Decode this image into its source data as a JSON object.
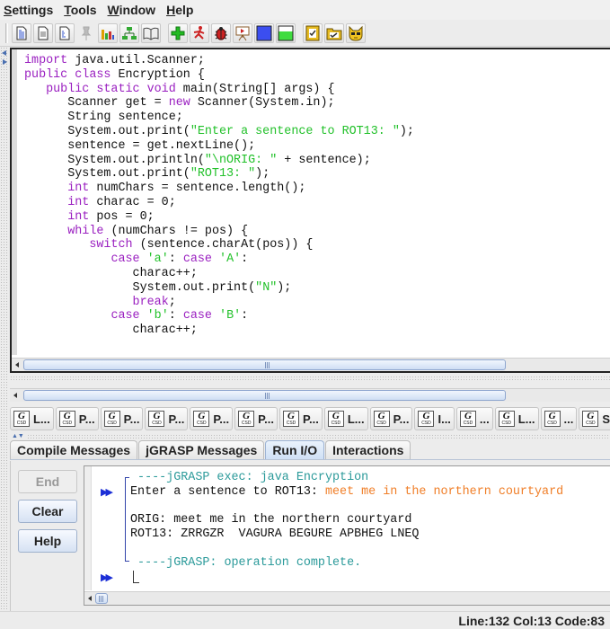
{
  "menubar": {
    "items": [
      {
        "label": "Settings",
        "mnemonic": "S",
        "rest": "ettings"
      },
      {
        "label": "Tools",
        "mnemonic": "T",
        "rest": "ools"
      },
      {
        "label": "Window",
        "mnemonic": "W",
        "rest": "indow"
      },
      {
        "label": "Help",
        "mnemonic": "H",
        "rest": "elp"
      }
    ]
  },
  "toolbar": {
    "buttons": [
      {
        "icon": "new-file-icon"
      },
      {
        "icon": "open-file-icon"
      },
      {
        "icon": "file-icon"
      },
      {
        "icon": "pin-icon",
        "disabled": true
      },
      {
        "icon": "bar-chart-icon"
      },
      {
        "icon": "hierarchy-icon"
      },
      {
        "icon": "book-icon"
      },
      {
        "icon": "compile-plus-icon"
      },
      {
        "icon": "run-figure-icon"
      },
      {
        "icon": "debug-bug-icon"
      },
      {
        "icon": "presentation-icon"
      },
      {
        "icon": "blue-square-icon"
      },
      {
        "icon": "green-window-icon"
      },
      {
        "icon": "checklist-icon"
      },
      {
        "icon": "check-folder-icon"
      },
      {
        "icon": "cat-face-icon"
      }
    ]
  },
  "editor": {
    "lines": [
      [
        {
          "t": "import",
          "c": "kw"
        },
        {
          "t": " java.util.Scanner;"
        }
      ],
      [
        {
          "t": "public class",
          "c": "kw"
        },
        {
          "t": " Encryption {"
        }
      ],
      [
        {
          "t": "   public static void",
          "c": "kw"
        },
        {
          "t": " main(String[] args) {"
        }
      ],
      [
        {
          "t": "      Scanner get = "
        },
        {
          "t": "new",
          "c": "kw"
        },
        {
          "t": " Scanner(System.in);"
        }
      ],
      [
        {
          "t": "      String sentence;"
        }
      ],
      [
        {
          "t": "      System.out.print("
        },
        {
          "t": "\"Enter a sentence to ROT13: \"",
          "c": "str"
        },
        {
          "t": ");"
        }
      ],
      [
        {
          "t": "      sentence = get.nextLine();"
        }
      ],
      [
        {
          "t": "      System.out.println("
        },
        {
          "t": "\"\\nORIG: \"",
          "c": "str"
        },
        {
          "t": " + sentence);"
        }
      ],
      [
        {
          "t": "      System.out.print("
        },
        {
          "t": "\"ROT13: \"",
          "c": "str"
        },
        {
          "t": ");"
        }
      ],
      [
        {
          "t": "      "
        },
        {
          "t": "int",
          "c": "kw"
        },
        {
          "t": " numChars = sentence.length();"
        }
      ],
      [
        {
          "t": "      "
        },
        {
          "t": "int",
          "c": "kw"
        },
        {
          "t": " charac = 0;"
        }
      ],
      [
        {
          "t": "      "
        },
        {
          "t": "int",
          "c": "kw"
        },
        {
          "t": " pos = 0;"
        }
      ],
      [
        {
          "t": "      "
        },
        {
          "t": "while",
          "c": "kw"
        },
        {
          "t": " (numChars != pos) {"
        }
      ],
      [
        {
          "t": "         "
        },
        {
          "t": "switch",
          "c": "kw"
        },
        {
          "t": " (sentence.charAt(pos)) {"
        }
      ],
      [
        {
          "t": "            "
        },
        {
          "t": "case",
          "c": "kw"
        },
        {
          "t": " "
        },
        {
          "t": "'a'",
          "c": "str"
        },
        {
          "t": ": "
        },
        {
          "t": "case",
          "c": "kw"
        },
        {
          "t": " "
        },
        {
          "t": "'A'",
          "c": "str"
        },
        {
          "t": ":"
        }
      ],
      [
        {
          "t": "               charac++;"
        }
      ],
      [
        {
          "t": "               System.out.print("
        },
        {
          "t": "\"N\"",
          "c": "str"
        },
        {
          "t": ");"
        }
      ],
      [
        {
          "t": "               "
        },
        {
          "t": "break",
          "c": "kw"
        },
        {
          "t": ";"
        }
      ],
      [
        {
          "t": "            "
        },
        {
          "t": "case",
          "c": "kw"
        },
        {
          "t": " "
        },
        {
          "t": "'b'",
          "c": "str"
        },
        {
          "t": ": "
        },
        {
          "t": "case",
          "c": "kw"
        },
        {
          "t": " "
        },
        {
          "t": "'B'",
          "c": "str"
        },
        {
          "t": ":"
        }
      ],
      [
        {
          "t": "               charac++;"
        }
      ]
    ]
  },
  "window_tabs": [
    "L...",
    "P...",
    "P...",
    "P...",
    "P...",
    "P...",
    "P...",
    "L...",
    "P...",
    "I...",
    "...",
    "L...",
    "...",
    "S"
  ],
  "message_tabs": [
    {
      "label": "Compile Messages",
      "active": false
    },
    {
      "label": "jGRASP Messages",
      "active": false
    },
    {
      "label": "Run I/O",
      "active": true
    },
    {
      "label": "Interactions",
      "active": false
    }
  ],
  "run_panel": {
    "buttons": {
      "end": "End",
      "clear": "Clear",
      "help": "Help"
    },
    "console": {
      "exec_line": " ----jGRASP exec: java Encryption",
      "prompt": "Enter a sentence to ROT13: ",
      "user_input": "meet me in the northern courtyard",
      "orig_line": "ORIG: meet me in the northern courtyard",
      "rot13_line": "ROT13: ZRRGZR  VAGURA BEGURE APBHEG LNEQ",
      "complete_line": " ----jGRASP: operation complete."
    }
  },
  "status": {
    "text": "Line:132  Col:13  Code:83"
  },
  "colors": {
    "keyword": "#9a1fc0",
    "string": "#22c12a",
    "console_system": "#2b9a9a",
    "console_input": "#f07e27",
    "run_arrow": "#1c2fd6"
  }
}
